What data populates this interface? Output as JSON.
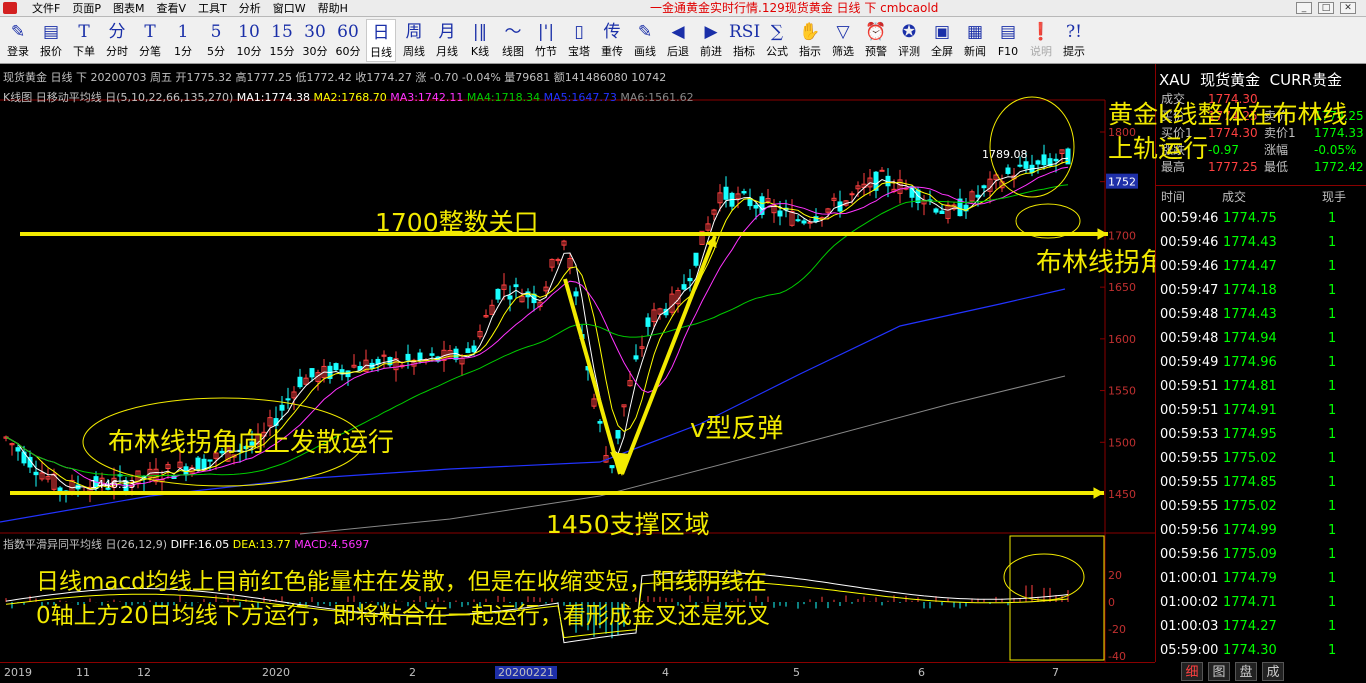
{
  "window": {
    "title": "一金通黄金实时行情.129现货黄金 日线 下 cmbcaold",
    "menu": [
      "文件F",
      "页面P",
      "图表M",
      "查看V",
      "工具T",
      "分析",
      "窗口W",
      "帮助H"
    ]
  },
  "toolbar": [
    {
      "glyph": "✎",
      "label": "登录"
    },
    {
      "glyph": "▤",
      "label": "报价"
    },
    {
      "glyph": "T",
      "label": "下单"
    },
    {
      "glyph": "分",
      "label": "分时"
    },
    {
      "glyph": "T",
      "label": "分笔"
    },
    {
      "glyph": "1",
      "label": "1分"
    },
    {
      "glyph": "5",
      "label": "5分"
    },
    {
      "glyph": "10",
      "label": "10分"
    },
    {
      "glyph": "15",
      "label": "15分"
    },
    {
      "glyph": "30",
      "label": "30分"
    },
    {
      "glyph": "60",
      "label": "60分"
    },
    {
      "glyph": "日",
      "label": "日线",
      "active": true
    },
    {
      "glyph": "周",
      "label": "周线"
    },
    {
      "glyph": "月",
      "label": "月线"
    },
    {
      "glyph": "|‖",
      "label": "K线"
    },
    {
      "glyph": "〜",
      "label": "线图"
    },
    {
      "glyph": "|'|",
      "label": "竹节"
    },
    {
      "glyph": "▯",
      "label": "宝塔"
    },
    {
      "glyph": "传",
      "label": "重传"
    },
    {
      "glyph": "✎",
      "label": "画线"
    },
    {
      "glyph": "◀",
      "label": "后退"
    },
    {
      "glyph": "▶",
      "label": "前进"
    },
    {
      "glyph": "RSI",
      "label": "指标"
    },
    {
      "glyph": "∑",
      "label": "公式"
    },
    {
      "glyph": "✋",
      "label": "指示"
    },
    {
      "glyph": "▽",
      "label": "筛选"
    },
    {
      "glyph": "⏰",
      "label": "预警"
    },
    {
      "glyph": "✪",
      "label": "评测"
    },
    {
      "glyph": "▣",
      "label": "全屏"
    },
    {
      "glyph": "▦",
      "label": "新闻"
    },
    {
      "glyph": "▤",
      "label": "F10"
    },
    {
      "glyph": "❗",
      "label": "说明",
      "dim": true
    },
    {
      "glyph": "?!",
      "label": "提示"
    }
  ],
  "chart": {
    "info": "现货黄金 日线 下 20200703 周五 开1775.32 高1777.25 低1772.42 收1774.27 涨 -0.70 -0.04% 量79681 额141486080 10742",
    "ma": {
      "title": "K线图 日移动平均线 日(5,10,22,66,135,270)",
      "ma1": "MA1:1774.38",
      "ma2": "MA2:1768.70",
      "ma3": "MA3:1742.11",
      "ma4": "MA4:1718.34",
      "ma5": "MA5:1647.73",
      "ma6": "MA6:1561.62"
    },
    "indicator": {
      "title": "指数平滑异同平均线 日(26,12,9)",
      "diff": "DIFF:16.05",
      "dea": "DEA:13.77",
      "macd": "MACD:4.5697"
    },
    "price_axis": [
      "1800",
      "1752",
      "1700",
      "1650",
      "1600",
      "1550",
      "1500",
      "1450"
    ],
    "indicator_axis": [
      "20",
      "0",
      "-20",
      "-40"
    ],
    "marks": {
      "high": "1789.08",
      "low": "1446.33",
      "current": "1752"
    },
    "xaxis": [
      "2019",
      "11",
      "12",
      "2020",
      "2",
      "20200221",
      "4",
      "5",
      "6",
      "7"
    ],
    "colors": {
      "up": "#ff4040",
      "down": "#19ffff",
      "ma1": "#ffffff",
      "ma2": "#ffff00",
      "ma3": "#ff33ff",
      "ma4": "#00cc00",
      "ma5": "#2233ff",
      "ma6": "#888888",
      "annotation": "#f2ea00"
    }
  },
  "annotations": {
    "gold_trend": "黄金k线整体在布林线上轨运行",
    "keylevel": "1700整数关口",
    "bollinger_right": "布林线拐角向上发散运行",
    "bollinger_left": "布林线拐角向上发散运行",
    "v_rebound": "v型反弹",
    "support": "1450支撑区域",
    "macd_line1": "日线macd均线上目前红色能量柱在发散，但是在收缩变短，阳线阴线在",
    "macd_line2": "0轴上方20日均线下方运行，即将粘合在一起运行，看形成金叉还是死叉"
  },
  "quote_panel": {
    "symbol": "XAU",
    "name": "现货黄金",
    "market": "CURR贵金",
    "rows": [
      {
        "l1": "成交",
        "v1": "1774.30",
        "l2": "",
        "v2": ""
      },
      {
        "l1": "买价",
        "v1": "1774.25",
        "l2": "卖价",
        "v2": "1774.25"
      },
      {
        "l1": "买价1",
        "v1": "1774.30",
        "l2": "卖价1",
        "v2": "1774.33"
      },
      {
        "l1": "涨跌",
        "v1": "-0.97",
        "l2": "涨幅",
        "v2": "-0.05%"
      },
      {
        "l1": "最高",
        "v1": "1777.25",
        "l2": "最低",
        "v2": "1772.42"
      }
    ],
    "trade_head": [
      "时间",
      "成交",
      "现手"
    ],
    "trades": [
      [
        "00:59:46",
        "1774.75",
        "1"
      ],
      [
        "00:59:46",
        "1774.43",
        "1"
      ],
      [
        "00:59:46",
        "1774.47",
        "1"
      ],
      [
        "00:59:47",
        "1774.18",
        "1"
      ],
      [
        "00:59:48",
        "1774.43",
        "1"
      ],
      [
        "00:59:48",
        "1774.94",
        "1"
      ],
      [
        "00:59:49",
        "1774.96",
        "1"
      ],
      [
        "00:59:51",
        "1774.81",
        "1"
      ],
      [
        "00:59:51",
        "1774.91",
        "1"
      ],
      [
        "00:59:53",
        "1774.95",
        "1"
      ],
      [
        "00:59:55",
        "1775.02",
        "1"
      ],
      [
        "00:59:55",
        "1774.85",
        "1"
      ],
      [
        "00:59:55",
        "1775.02",
        "1"
      ],
      [
        "00:59:56",
        "1774.99",
        "1"
      ],
      [
        "00:59:56",
        "1775.09",
        "1"
      ],
      [
        "01:00:01",
        "1774.79",
        "1"
      ],
      [
        "01:00:02",
        "1774.71",
        "1"
      ],
      [
        "01:00:03",
        "1774.27",
        "1"
      ],
      [
        "05:59:00",
        "1774.30",
        "1"
      ]
    ],
    "tabs": [
      "细",
      "图",
      "盘",
      "成"
    ]
  }
}
